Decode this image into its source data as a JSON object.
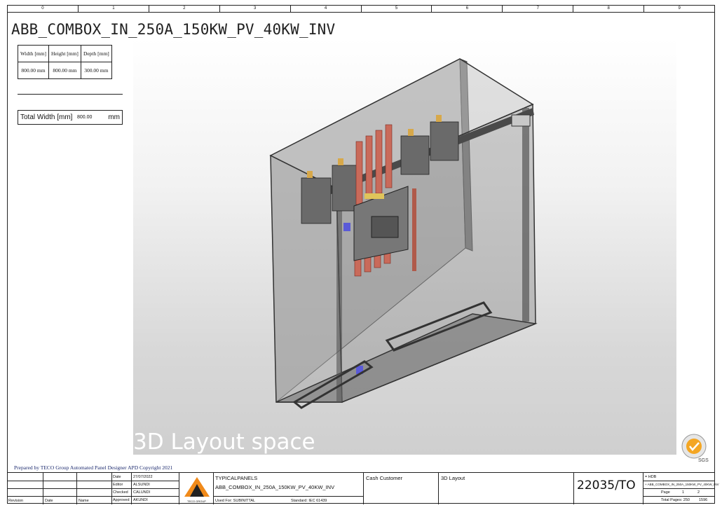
{
  "ruler": [
    "0",
    "1",
    "2",
    "3",
    "4",
    "5",
    "6",
    "7",
    "8",
    "9"
  ],
  "title": "ABB_COMBOX_IN_250A_150KW_PV_40KW_INV",
  "dimensions": {
    "headers": [
      "Width [mm]",
      "Height [mm]",
      "Depth [mm]"
    ],
    "values": [
      "800.00 mm",
      "800.00 mm",
      "300.00 mm"
    ]
  },
  "total_width": {
    "label": "Total Width [mm]",
    "value": "800.00",
    "unit": "mm"
  },
  "layout_label": "3D Layout space",
  "prepared_by": "Prepared by TECO Group Automated Panel Designer APD Copyright 2021",
  "title_block": {
    "revision_header": "Revision",
    "date_header": "Date",
    "name_header": "Name",
    "date_label": "Date",
    "date_value": "27/07/2022",
    "editor_label": "Editor",
    "editor_value": "ALSUNDI",
    "checked_label": "Checked",
    "checked_value": "CALUNDI",
    "approved_label": "Approved",
    "approved_value": "AKUNDI",
    "logo_caption": "TECO GROUP",
    "project_line1": "TYPICALPANELS",
    "project_line2": "ABB_COMBOX_IN_250A_150KW_PV_40KW_INV",
    "used_for": "Used For:  SUBINITTAL",
    "standard": "Standard:  IEC 61439",
    "customer": "Cash Customer",
    "sheet_type": "3D Layout",
    "drawing_no": "22035/TO",
    "ref1": "= HDB",
    "ref2": "+ ABB_COMBOX_IN_250A_150KW_PV_40KW_INV",
    "page_label": "Page",
    "page_value": "1",
    "page_total": "2",
    "total_pages_label": "Total Pages: 250",
    "total_pages_value": "1596"
  },
  "cert_badge": "SGS",
  "colors": {
    "enclosure": "#8a8a8a",
    "busbar": "#c96a5a",
    "title_text": "#1c2a6e"
  }
}
